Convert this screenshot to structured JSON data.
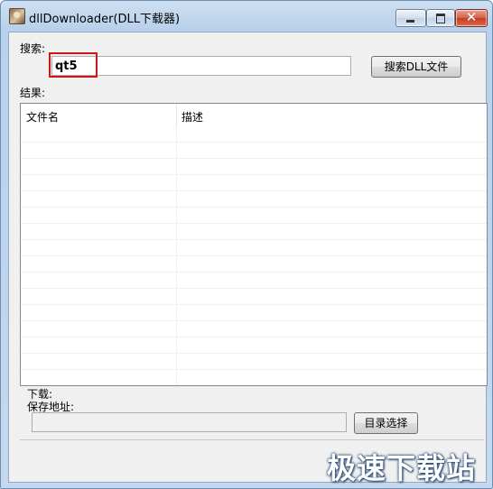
{
  "window": {
    "title": "dllDownloader(DLL下载器)",
    "controls": {
      "minimize": "minimize",
      "maximize": "maximize",
      "close": "✕"
    }
  },
  "search": {
    "label": "搜索:",
    "value": "qt5",
    "button_label": "搜索DLL文件"
  },
  "results": {
    "label": "结果:",
    "columns": [
      "文件名",
      "描述"
    ],
    "rows": []
  },
  "download": {
    "label": "下载:",
    "save_path_label": "保存地址:",
    "save_path_value": "",
    "dir_button_label": "目录选择"
  },
  "watermark": {
    "text": "极速下载站"
  },
  "colors": {
    "highlight": "#d0161b",
    "title_gradient": "#b9d1ea"
  }
}
